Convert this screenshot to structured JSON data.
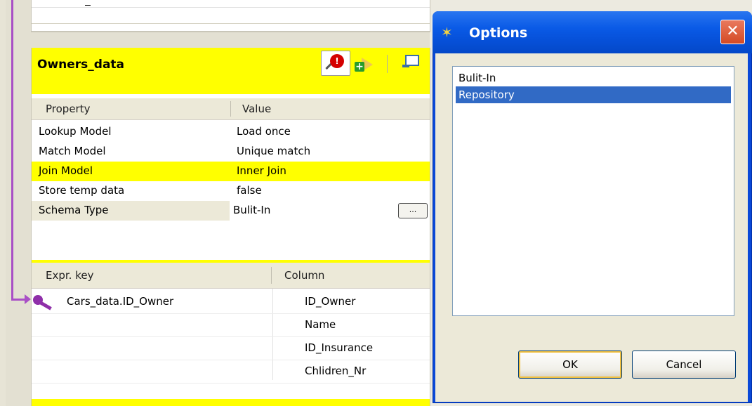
{
  "panel": {
    "title": "Owners_data",
    "zoom_badge": "!",
    "properties_header": {
      "property": "Property",
      "value": "Value"
    },
    "properties": [
      {
        "property": "Lookup Model",
        "value": "Load once"
      },
      {
        "property": "Match Model",
        "value": "Unique match"
      },
      {
        "property": "Join Model",
        "value": "Inner Join"
      },
      {
        "property": "Store temp data",
        "value": "false"
      },
      {
        "property": "Schema Type",
        "value": "Bulit-In"
      }
    ],
    "browse_label": "...",
    "key_header": {
      "expr": "Expr. key",
      "column": "Column"
    },
    "key_rows": [
      {
        "expr": "Cars_data.ID_Owner",
        "column": "ID_Owner"
      },
      {
        "expr": "",
        "column": "Name"
      },
      {
        "expr": "",
        "column": "ID_Insurance"
      },
      {
        "expr": "",
        "column": "Chlidren_Nr"
      }
    ]
  },
  "dialog": {
    "title": "Options",
    "close_glyph": "✕",
    "options": [
      "Bulit-In",
      "Repository"
    ],
    "selected": "Repository",
    "ok_label": "OK",
    "cancel_label": "Cancel"
  },
  "colors": {
    "header_yellow": "#ffff00",
    "selection_blue": "#316ac5",
    "link_purple": "#a94fc6",
    "titlebar_blue": "#0a5ae6"
  }
}
